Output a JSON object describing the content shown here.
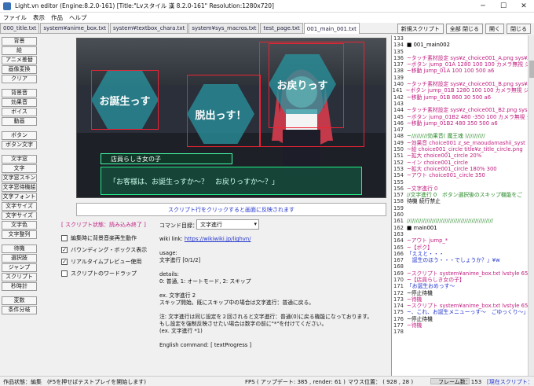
{
  "window": {
    "title": "Light.vn editor (Engine:8.2.0-161) [Title:\"Lvスタイル 漢 8.2.0-161\" Resolution:1280x720]"
  },
  "menu": [
    "ファイル",
    "表示",
    "作品",
    "ヘルプ"
  ],
  "tabs": [
    "000_title.txt",
    "system¥anime_box.txt",
    "system¥textbox_chara.txt",
    "system¥sys_macros.txt",
    "test_page.txt",
    "001_main_001.txt"
  ],
  "top_buttons": [
    "新規スクリプト",
    "全部 閉じる",
    "開く",
    "閉じる"
  ],
  "sidebar": {
    "group1": [
      "背景",
      "絵",
      "アニメ差替",
      "画像変換",
      "クリア"
    ],
    "group2": [
      "背景音",
      "効果音",
      "ボイス",
      "動画"
    ],
    "group3": [
      "ボタン",
      "ボタン文字"
    ],
    "group4": [
      "文字窓",
      "文字",
      "文字窓スキン",
      "文字窓待機絵",
      "文字フォント",
      "文字サイズ",
      "文字サイズ",
      "文字色",
      "文字整列"
    ],
    "group5": [
      "待機",
      "選択肢",
      "ジャンプ",
      "スクリプト",
      "秒時計"
    ],
    "group6": [
      "変数",
      "条件分岐"
    ]
  },
  "preview": {
    "choices": [
      "お誕生っす",
      "脱出っす！",
      "お戻りっす"
    ],
    "name": "店員らしき女の子",
    "message": "「お客様は、お誕生っすか〜？　お戻りっすか〜？」"
  },
  "hint": "スクリプト行をクリックすると画面に反映されます",
  "script_status": "[ スクリプト状態：読み込み終了 ]",
  "options": [
    {
      "label": "編集時に背景音楽再生動作",
      "checked": false
    },
    {
      "label": "バウンディング・ボックス表示",
      "checked": true
    },
    {
      "label": "リアルタイムプレビュー使用",
      "checked": true
    },
    {
      "label": "スクリプトのワードラップ",
      "checked": false
    }
  ],
  "command": {
    "label": "コマンド目録：",
    "selected": "文字進行"
  },
  "help": {
    "wiki_label": "wiki link: ",
    "wiki_url": "https://wikiwiki.jp/lighvn/",
    "usage_title": "usage:",
    "usage": "文字進行 [0/1/2]",
    "details_title": "details:",
    "details": "0: 普通, 1: オートモード, 2: スキップ",
    "ex_title": "ex. 文字進行 2",
    "ex_body": "スキップ開始。既にスキップ中の場合は文字進行：普通に戻る。",
    "note1": "注: 文字進行は同じ設定を２回されると文字進行：普通(0)に戻る機能になっております。",
    "note2": "もし設定を強制反映させたい場合は数字の前に\"*\"を付けてください。",
    "note3": "(ex. 文字進行 *1)",
    "english": "English command: [ textProgress ]"
  },
  "code_lines": [
    {
      "n": "133",
      "t": "",
      "c": "#000"
    },
    {
      "n": "134",
      "t": "■ 001_main002",
      "c": "#000"
    },
    {
      "n": "135",
      "t": "",
      "c": "#000"
    },
    {
      "n": "136",
      "t": "~タッチ素材設定 sys¥z_choice001_A.png sys¥z",
      "c": "#c02080"
    },
    {
      "n": "137",
      "t": "~ボタン jump_01A 1280 100 100 カメラ無視 ジ",
      "c": "#c02080"
    },
    {
      "n": "138",
      "t": "~移動 jump_01A 100 100 500 a6",
      "c": "#c02080"
    },
    {
      "n": "139",
      "t": "",
      "c": "#000"
    },
    {
      "n": "140",
      "t": "~タッチ素材設定 sys¥z_choice001_B.png sys¥z",
      "c": "#c02080"
    },
    {
      "n": "141",
      "t": "~ボタン jump_01B 1280 100 100 カメラ無視 ジャ",
      "c": "#c02080"
    },
    {
      "n": "142",
      "t": "~移動 jump_01B 860 30 500 a6",
      "c": "#c02080"
    },
    {
      "n": "143",
      "t": "",
      "c": "#000"
    },
    {
      "n": "144",
      "t": "~タッチ素材設定 sys¥z_choice001_B2.png sys",
      "c": "#c02080"
    },
    {
      "n": "145",
      "t": "~ボタン jump_01B2 480 -350 100 カメラ無視 ジ",
      "c": "#c02080"
    },
    {
      "n": "146",
      "t": "~移動 jump_01B2 480 350 500 a6",
      "c": "#c02080"
    },
    {
      "n": "147",
      "t": "",
      "c": "#000"
    },
    {
      "n": "148",
      "t": "~/////////効果音( 魔王魂 )//////////",
      "c": "#2a8a2a"
    },
    {
      "n": "149",
      "t": "~効果音 choice001 z_se_maoudamashii_syst",
      "c": "#c02080"
    },
    {
      "n": "150",
      "t": "~絵 choice001_circle title¥z_title_circle.png",
      "c": "#c02080"
    },
    {
      "n": "151",
      "t": "~拡大 choice001_circle 20%",
      "c": "#c02080"
    },
    {
      "n": "152",
      "t": "~イン choice001_circle",
      "c": "#c02080"
    },
    {
      "n": "153",
      "t": "~拡大 choice001_circle 180% 300",
      "c": "#c02080"
    },
    {
      "n": "154",
      "t": "~アウト choice001_circle 350",
      "c": "#c02080"
    },
    {
      "n": "155",
      "t": "",
      "c": "#000"
    },
    {
      "n": "156",
      "t": "~文字進行 0",
      "c": "#c02080"
    },
    {
      "n": "157",
      "t": "//文字進行 0　ボタン選択後のスキップ機能をご",
      "c": "#2a8a2a"
    },
    {
      "n": "158",
      "t": "待機 続行禁止",
      "c": "#000"
    },
    {
      "n": "159",
      "t": "",
      "c": "#000"
    },
    {
      "n": "160",
      "t": "",
      "c": "#000"
    },
    {
      "n": "161",
      "t": "////////////////////////////////////////////////",
      "c": "#2a8a2a"
    },
    {
      "n": "162",
      "t": "■ main001",
      "c": "#000"
    },
    {
      "n": "163",
      "t": "",
      "c": "#000"
    },
    {
      "n": "164",
      "t": "~アウト jump_*",
      "c": "#c02080"
    },
    {
      "n": "165",
      "t": "~【ポク】",
      "c": "#c02080"
    },
    {
      "n": "166",
      "t": "「ええと・・・",
      "c": "#2233cc"
    },
    {
      "n": "167",
      "t": "　誕生のほう・・・でしょうか？」¥w",
      "c": "#2233cc"
    },
    {
      "n": "168",
      "t": "",
      "c": "#000"
    },
    {
      "n": "169",
      "t": "~スクリプト system¥anime_box.txt lvstyle 650",
      "c": "#c02080"
    },
    {
      "n": "170",
      "t": "~【店員らしき女の子】",
      "c": "#c02080"
    },
    {
      "n": "171",
      "t": "「お誕生おめっす～",
      "c": "#2233cc"
    },
    {
      "n": "172",
      "t": "~停止待機",
      "c": "#000"
    },
    {
      "n": "173",
      "t": "~待機",
      "c": "#c02080"
    },
    {
      "n": "174",
      "t": "~スクリプト system¥anime_box.txt lvstyle 650",
      "c": "#c02080"
    },
    {
      "n": "175",
      "t": "~、これ、お誕生メニューっす～　ごゆっくり～」",
      "c": "#2233cc"
    },
    {
      "n": "176",
      "t": "~停止待機",
      "c": "#000"
    },
    {
      "n": "177",
      "t": "~待機",
      "c": "#c02080"
    },
    {
      "n": "178",
      "t": "",
      "c": "#000"
    }
  ],
  "statusbar": {
    "left": "作品状態：編集　(F5を押せばテストプレイを開始します)",
    "fps": "FPS ( アップデート: 385 , render: 61 )",
    "mouse": "マウス位置： ( 928 , 28 )",
    "frame": "フレーム数：153",
    "right": "[現在スクリプト：既"
  },
  "colors": {
    "accent": "#2233cc",
    "command_pink": "#c02080",
    "comment_green": "#2a8a2a",
    "choice_teal": "#2896a0"
  }
}
